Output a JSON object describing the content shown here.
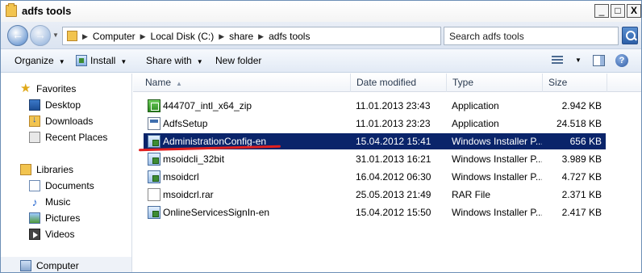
{
  "window": {
    "title": "adfs tools",
    "buttons": {
      "minimize": "_",
      "maximize": "□",
      "close": "X"
    }
  },
  "address": {
    "crumbs": [
      "Computer",
      "Local Disk (C:)",
      "share",
      "adfs tools"
    ],
    "search_placeholder": "Search adfs tools"
  },
  "toolbar": {
    "organize": "Organize",
    "install": "Install",
    "share_with": "Share with",
    "new_folder": "New folder"
  },
  "nav": {
    "favorites": "Favorites",
    "desktop": "Desktop",
    "downloads": "Downloads",
    "recent_places": "Recent Places",
    "libraries": "Libraries",
    "documents": "Documents",
    "music": "Music",
    "pictures": "Pictures",
    "videos": "Videos",
    "computer": "Computer"
  },
  "columns": {
    "name": "Name",
    "date_modified": "Date modified",
    "type": "Type",
    "size": "Size"
  },
  "files": [
    {
      "name": "444707_intl_x64_zip",
      "date": "11.01.2013 23:43",
      "type": "Application",
      "size": "2.942 KB",
      "icon": "application-icon"
    },
    {
      "name": "AdfsSetup",
      "date": "11.01.2013 23:23",
      "type": "Application",
      "size": "24.518 KB",
      "icon": "setup-icon"
    },
    {
      "name": "AdministrationConfig-en",
      "date": "15.04.2012 15:41",
      "type": "Windows Installer P...",
      "size": "656 KB",
      "icon": "msi-icon",
      "selected": true
    },
    {
      "name": "msoidcli_32bit",
      "date": "31.01.2013 16:21",
      "type": "Windows Installer P...",
      "size": "3.989 KB",
      "icon": "msi-icon"
    },
    {
      "name": "msoidcrl",
      "date": "16.04.2012 06:30",
      "type": "Windows Installer P...",
      "size": "4.727 KB",
      "icon": "msi-icon"
    },
    {
      "name": "msoidcrl.rar",
      "date": "25.05.2013 21:49",
      "type": "RAR File",
      "size": "2.371 KB",
      "icon": "rar-file-icon"
    },
    {
      "name": "OnlineServicesSignIn-en",
      "date": "15.04.2012 15:50",
      "type": "Windows Installer P...",
      "size": "2.417 KB",
      "icon": "msi-icon"
    }
  ],
  "colors": {
    "selection": "#0a246a",
    "annotation_underline": "#e02020"
  }
}
